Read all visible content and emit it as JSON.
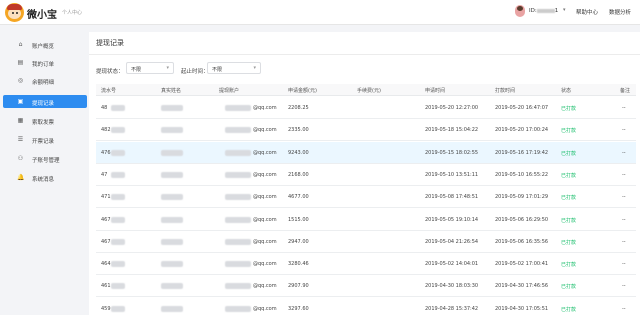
{
  "header": {
    "brand": "微小宝",
    "subtitle": "个人中心",
    "user_id_text": "ID:",
    "user_id_tail": "1",
    "caret": "▾",
    "links": [
      "帮助中心",
      "数据分析"
    ]
  },
  "sidebar": {
    "items": [
      {
        "label": "账户概览",
        "icon": "home-icon",
        "glyph": "⌂"
      },
      {
        "label": "我的订单",
        "icon": "order-icon",
        "glyph": "▤"
      },
      {
        "label": "余额明细",
        "icon": "balance-icon",
        "glyph": "◎"
      },
      {
        "label": "提现记录",
        "icon": "wallet-icon",
        "glyph": "▣"
      },
      {
        "label": "索取发票",
        "icon": "invoice-icon",
        "glyph": "▦"
      },
      {
        "label": "开票记录",
        "icon": "record-icon",
        "glyph": "☰"
      },
      {
        "label": "子账号管理",
        "icon": "subaccount-icon",
        "glyph": "⚇"
      },
      {
        "label": "系统消息",
        "icon": "bell-icon",
        "glyph": "🔔"
      }
    ],
    "active_index": 3
  },
  "panel": {
    "title": "提现记录",
    "filters": {
      "status_label": "提现状态：",
      "status_value": "不限",
      "time_label": "起止时间：",
      "time_value": "不限"
    }
  },
  "table": {
    "headers": [
      "流水号",
      "真实姓名",
      "提现账户",
      "申请金额(元)",
      "手续费(元)",
      "申请时间",
      "打款时间",
      "状态",
      "备注"
    ],
    "rows": [
      {
        "id": "48",
        "account": "@qq.com",
        "amount": "2208.25",
        "fee": "",
        "apply": "2019-05-20 12:27:00",
        "paid": "2019-05-20 16:47:07",
        "status": "已打款",
        "note": "--"
      },
      {
        "id": "482",
        "account": "@qq.com",
        "amount": "2335.00",
        "fee": "",
        "apply": "2019-05-18 15:04:22",
        "paid": "2019-05-20 17:00:24",
        "status": "已打款",
        "note": "--"
      },
      {
        "id": "476",
        "account": "@qq.com",
        "amount": "9243.00",
        "fee": "",
        "apply": "2019-05-15 18:02:55",
        "paid": "2019-05-16 17:19:42",
        "status": "已打款",
        "note": "--"
      },
      {
        "id": "47",
        "account": "@qq.com",
        "amount": "2168.00",
        "fee": "",
        "apply": "2019-05-10 13:51:11",
        "paid": "2019-05-10 16:55:22",
        "status": "已打款",
        "note": "--"
      },
      {
        "id": "471",
        "account": "@qq.com",
        "amount": "4677.00",
        "fee": "",
        "apply": "2019-05-08 17:48:51",
        "paid": "2019-05-09 17:01:29",
        "status": "已打款",
        "note": "--"
      },
      {
        "id": "467",
        "account": "@qq.com",
        "amount": "1515.00",
        "fee": "",
        "apply": "2019-05-05 19:10:14",
        "paid": "2019-05-06 16:29:50",
        "status": "已打款",
        "note": "--"
      },
      {
        "id": "467",
        "account": "@qq.com",
        "amount": "2947.00",
        "fee": "",
        "apply": "2019-05-04 21:26:54",
        "paid": "2019-05-06 16:35:56",
        "status": "已打款",
        "note": "--"
      },
      {
        "id": "464",
        "account": "@qq.com",
        "amount": "3280.46",
        "fee": "",
        "apply": "2019-05-02 14:04:01",
        "paid": "2019-05-02 17:00:41",
        "status": "已打款",
        "note": "--"
      },
      {
        "id": "461",
        "account": "@qq.com",
        "amount": "2907.90",
        "fee": "",
        "apply": "2019-04-30 18:03:30",
        "paid": "2019-04-30 17:46:56",
        "status": "已打款",
        "note": "--"
      },
      {
        "id": "459",
        "account": "@qq.com",
        "amount": "3297.60",
        "fee": "",
        "apply": "2019-04-28 15:37:42",
        "paid": "2019-04-30 17:05:51",
        "status": "已打款",
        "note": "--"
      }
    ],
    "highlight_row": 2
  },
  "colors": {
    "accent": "#2d8cf0",
    "status_paid": "#19be6b"
  }
}
